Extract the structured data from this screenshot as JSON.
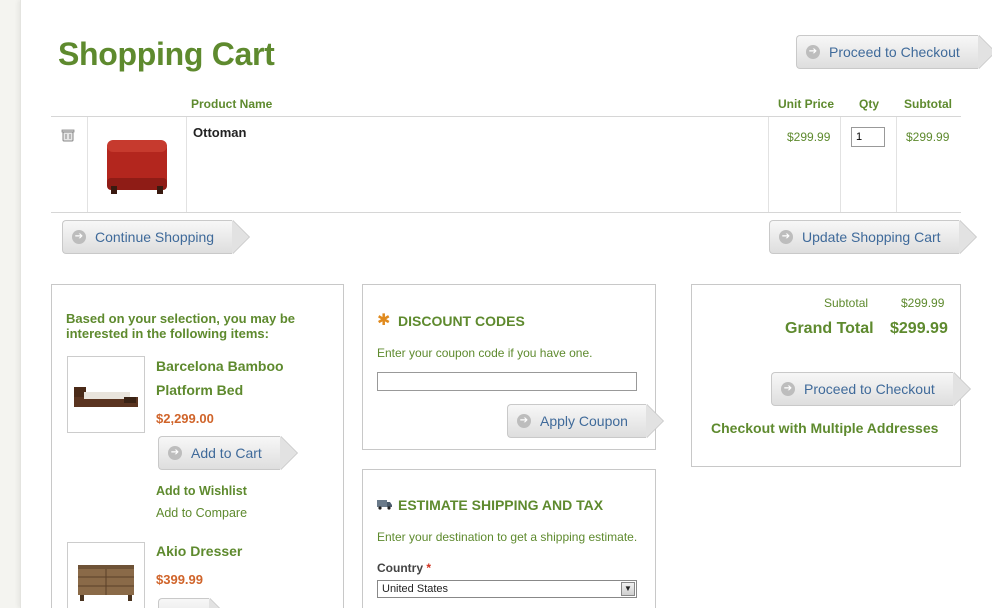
{
  "page": {
    "title": "Shopping Cart",
    "proceed_top_label": "Proceed to Checkout"
  },
  "cart_table": {
    "headers": {
      "product_name": "Product Name",
      "unit_price": "Unit Price",
      "qty": "Qty",
      "subtotal": "Subtotal"
    },
    "rows": [
      {
        "name": "Ottoman",
        "unit_price": "$299.99",
        "qty": "1",
        "subtotal": "$299.99",
        "image": "red-ottoman"
      }
    ]
  },
  "actions": {
    "continue_label": "Continue Shopping",
    "update_label": "Update Shopping Cart"
  },
  "crosssell": {
    "title": "Based on your selection, you may be interested in the following items:",
    "items": [
      {
        "name_line1": "Barcelona Bamboo",
        "name_line2": "Platform Bed",
        "price": "$2,299.00",
        "add_to_cart": "Add to Cart",
        "add_to_wishlist": "Add to Wishlist",
        "add_to_compare": "Add to Compare"
      },
      {
        "name_line1": "Akio Dresser",
        "price": "$399.99"
      }
    ]
  },
  "discount": {
    "title": "DISCOUNT CODES",
    "text": "Enter your coupon code if you have one.",
    "input_value": "",
    "apply_label": "Apply Coupon",
    "icon": "asterisk-icon"
  },
  "shipping": {
    "title": "ESTIMATE SHIPPING AND TAX",
    "text": "Enter your destination to get a shipping estimate.",
    "country_label": "Country",
    "required_mark": "*",
    "country_value": "United States",
    "icon": "truck-icon"
  },
  "totals": {
    "subtotal_label": "Subtotal",
    "subtotal_value": "$299.99",
    "grand_label": "Grand Total",
    "grand_value": "$299.99",
    "proceed_label": "Proceed to Checkout",
    "multi_label": "Checkout with Multiple Addresses"
  },
  "colors": {
    "accent_green": "#5e8a2e",
    "price_orange": "#d0642a",
    "button_text_blue": "#3f6a9a"
  }
}
